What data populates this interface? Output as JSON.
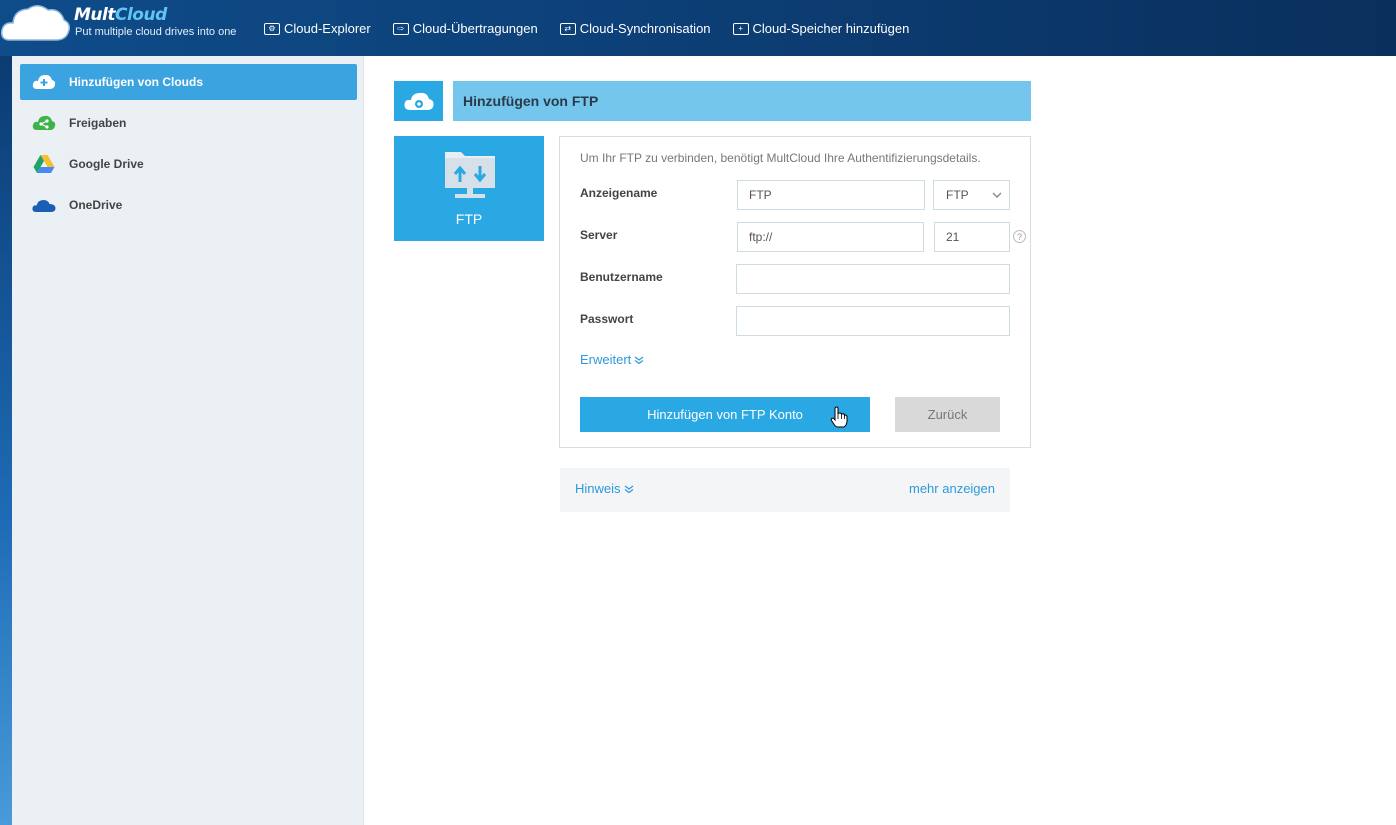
{
  "brand": {
    "name_prefix": "Mult",
    "name_suffix": "Cloud",
    "tagline": "Put multiple cloud drives into one",
    "accent": "#29a8e3"
  },
  "topnav": {
    "items": [
      {
        "label": "Cloud-Explorer",
        "icon": "gear-icon"
      },
      {
        "label": "Cloud-Übertragungen",
        "icon": "transfer-icon"
      },
      {
        "label": "Cloud-Synchronisation",
        "icon": "sync-icon"
      },
      {
        "label": "Cloud-Speicher hinzufügen",
        "icon": "plus-icon"
      }
    ]
  },
  "sidebar": {
    "items": [
      {
        "label": "Hinzufügen von Clouds",
        "icon": "cloud-add-icon",
        "active": true
      },
      {
        "label": "Freigaben",
        "icon": "share-icon",
        "active": false
      },
      {
        "label": "Google Drive",
        "icon": "google-drive-icon",
        "active": false
      },
      {
        "label": "OneDrive",
        "icon": "onedrive-icon",
        "active": false
      }
    ]
  },
  "main": {
    "header_title": "Hinzufügen von FTP",
    "tile_label": "FTP",
    "form": {
      "description": "Um Ihr FTP zu verbinden, benötigt MultCloud Ihre Authentifizierungsdetails.",
      "display_name_label": "Anzeigename",
      "display_name_value": "FTP",
      "protocol_value": "FTP",
      "server_label": "Server",
      "server_value": "ftp://",
      "port_value": "21",
      "help_glyph": "?",
      "username_label": "Benutzername",
      "username_value": "",
      "password_label": "Passwort",
      "password_value": "",
      "advanced_label": "Erweitert",
      "submit_label": "Hinzufügen von FTP Konto",
      "back_label": "Zurück"
    },
    "hint": {
      "label": "Hinweis",
      "more_label": "mehr anzeigen"
    }
  }
}
